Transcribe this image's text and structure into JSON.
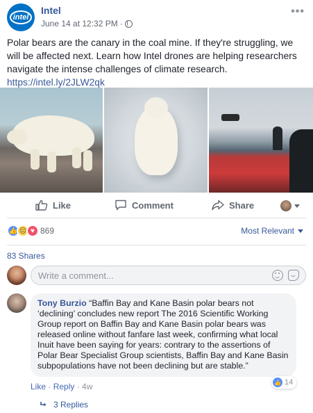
{
  "header": {
    "page_name": "Intel",
    "logo_text": "intel",
    "timestamp": "June 14 at 12:32 PM",
    "separator": "·"
  },
  "post": {
    "text": "Polar bears are the canary in the coal mine. If they're struggling, we will be affected next. Learn how Intel drones are helping researchers navigate the intense challenges of climate research.",
    "link": "https://intel.ly/2JLW2qk"
  },
  "actions": {
    "like_label": "Like",
    "comment_label": "Comment",
    "share_label": "Share"
  },
  "reactions": {
    "count": "869",
    "sort_label": "Most Relevant"
  },
  "shares": {
    "label": "83 Shares"
  },
  "comment_box": {
    "placeholder": "Write a comment..."
  },
  "comment": {
    "author": "Tony Burzio",
    "text": " “Baffin Bay and Kane Basin polar bears not ‘declining’ concludes new report The 2016 Scientific Working Group report on Baffin Bay and Kane Basin polar bears was released online without fanfare last week, confirming what local Inuit have been saying for years: contrary to the assertions of Polar Bear Specialist Group scientists, Baffin Bay and Kane Basin subpopulations have not been declining but are stable.”",
    "like_count": "14",
    "like_label": "Like",
    "reply_label": "Reply",
    "age": "4w",
    "dot": " · ",
    "replies_label": "3 Replies"
  },
  "colors": {
    "link_blue": "#365899",
    "intel_blue": "#0071c5",
    "like_blue": "#5890ff",
    "love_red": "#f25268",
    "sad_yellow": "#f7d254"
  },
  "icons": {
    "more": "more-horizontal-icon",
    "audience": "globe-icon",
    "like": "thumbs-up-icon",
    "comment": "speech-bubble-icon",
    "share": "share-arrow-icon",
    "emoji": "smiley-icon",
    "sticker": "sticker-icon",
    "reply": "reply-arrow-icon"
  }
}
